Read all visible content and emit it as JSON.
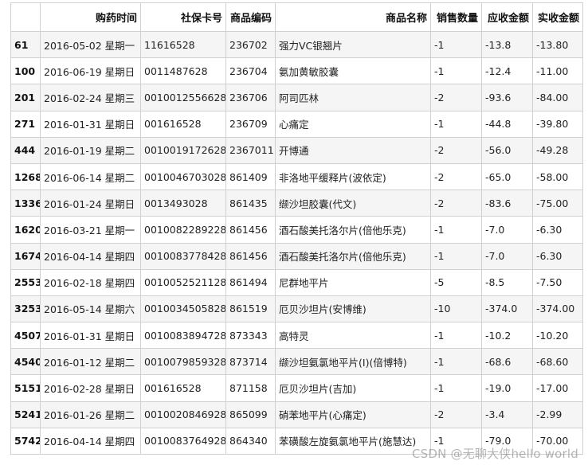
{
  "table": {
    "headers": [
      "",
      "购药时间",
      "社保卡号",
      "商品编码",
      "商品名称",
      "销售数量",
      "应收金额",
      "实收金额"
    ],
    "rows": [
      [
        "61",
        "2016-05-02 星期一",
        "11616528",
        "236702",
        "强力VC银翘片",
        "-1",
        "-13.8",
        "-13.80"
      ],
      [
        "100",
        "2016-06-19 星期日",
        "0011487628",
        "236704",
        "氨加黄敏胶囊",
        "-1",
        "-12.4",
        "-11.00"
      ],
      [
        "201",
        "2016-02-24 星期三",
        "0010012556628",
        "236706",
        "阿司匹林",
        "-2",
        "-93.6",
        "-84.00"
      ],
      [
        "271",
        "2016-01-31 星期日",
        "001616528",
        "236709",
        "心痛定",
        "-1",
        "-44.8",
        "-39.80"
      ],
      [
        "444",
        "2016-01-19 星期二",
        "0010019172628",
        "2367011",
        "开博通",
        "-2",
        "-56.0",
        "-49.28"
      ],
      [
        "1268",
        "2016-06-14 星期二",
        "0010046703028",
        "861409",
        "非洛地平缓释片(波依定)",
        "-2",
        "-65.0",
        "-58.00"
      ],
      [
        "1336",
        "2016-01-24 星期日",
        "0013493028",
        "861435",
        "缬沙坦胶囊(代文)",
        "-2",
        "-83.6",
        "-75.00"
      ],
      [
        "1620",
        "2016-03-21 星期一",
        "0010082289228",
        "861456",
        "酒石酸美托洛尔片(倍他乐克)",
        "-1",
        "-7.0",
        "-6.30"
      ],
      [
        "1674",
        "2016-04-14 星期四",
        "0010083778428",
        "861456",
        "酒石酸美托洛尔片(倍他乐克)",
        "-1",
        "-7.0",
        "-6.30"
      ],
      [
        "2553",
        "2016-02-18 星期四",
        "0010052521128",
        "861494",
        "尼群地平片",
        "-5",
        "-8.5",
        "-7.50"
      ],
      [
        "3253",
        "2016-05-14 星期六",
        "0010034505828",
        "861519",
        "厄贝沙坦片(安博维)",
        "-10",
        "-374.0",
        "-374.00"
      ],
      [
        "4507",
        "2016-01-31 星期日",
        "0010083894728",
        "873343",
        "高特灵",
        "-1",
        "-10.2",
        "-10.20"
      ],
      [
        "4540",
        "2016-01-12 星期二",
        "0010079859328",
        "873714",
        "缬沙坦氨氯地平片(I)(倍博特)",
        "-1",
        "-68.6",
        "-68.60"
      ],
      [
        "5151",
        "2016-02-28 星期日",
        "001616528",
        "871158",
        "厄贝沙坦片(吉加)",
        "-1",
        "-19.0",
        "-17.00"
      ],
      [
        "5241",
        "2016-01-26 星期二",
        "0010020846928",
        "865099",
        "硝苯地平片(心痛定)",
        "-2",
        "-3.4",
        "-2.99"
      ],
      [
        "5742",
        "2016-04-14 星期四",
        "0010083764928",
        "864340",
        "苯磺酸左旋氨氯地平片(施慧达)",
        "-1",
        "-79.0",
        "-70.00"
      ]
    ]
  },
  "watermark": "CSDN @无聊大侠hello world"
}
